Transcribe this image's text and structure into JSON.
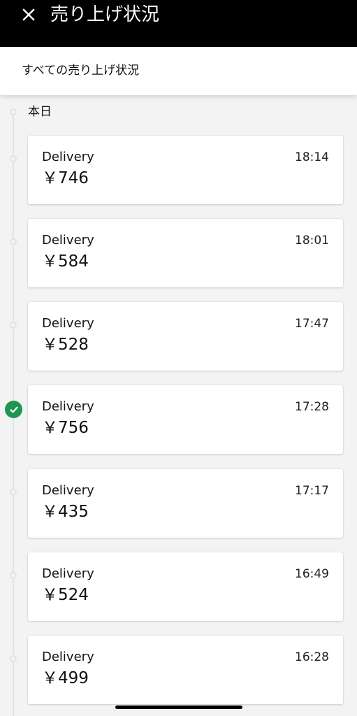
{
  "header": {
    "title": "売り上げ状況",
    "close_icon": "close-icon"
  },
  "filter": {
    "label": "すべての売り上げ状況"
  },
  "timeline": {
    "section_label": "本日",
    "check_color": "#1e9651",
    "entries": [
      {
        "type": "Delivery",
        "time": "18:14",
        "amount": "￥746",
        "checked": false
      },
      {
        "type": "Delivery",
        "time": "18:01",
        "amount": "￥584",
        "checked": false
      },
      {
        "type": "Delivery",
        "time": "17:47",
        "amount": "￥528",
        "checked": false
      },
      {
        "type": "Delivery",
        "time": "17:28",
        "amount": "￥756",
        "checked": true
      },
      {
        "type": "Delivery",
        "time": "17:17",
        "amount": "￥435",
        "checked": false
      },
      {
        "type": "Delivery",
        "time": "16:49",
        "amount": "￥524",
        "checked": false
      },
      {
        "type": "Delivery",
        "time": "16:28",
        "amount": "￥499",
        "checked": false
      }
    ]
  },
  "colors": {
    "header_bg": "#000000",
    "page_bg": "#f3f3f3",
    "card_bg": "#ffffff"
  }
}
